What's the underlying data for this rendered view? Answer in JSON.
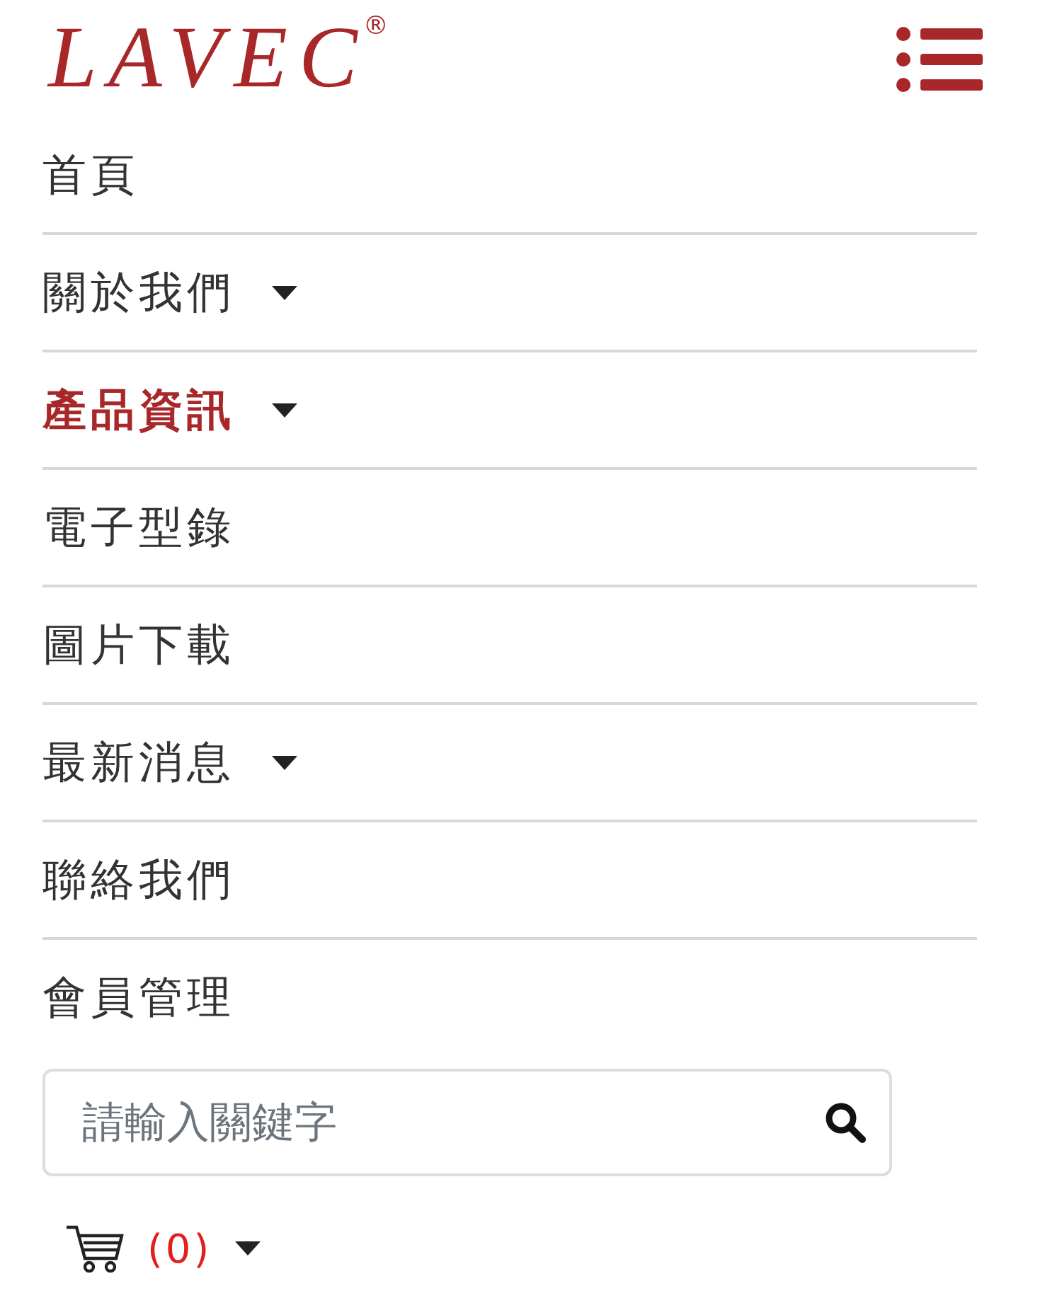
{
  "logo": {
    "text": "LAVEC",
    "mark": "®"
  },
  "menu": [
    {
      "label": "首頁",
      "selected": false,
      "dropdown": false
    },
    {
      "label": "關於我們",
      "selected": false,
      "dropdown": true
    },
    {
      "label": "產品資訊",
      "selected": true,
      "dropdown": true
    },
    {
      "label": "電子型錄",
      "selected": false,
      "dropdown": false
    },
    {
      "label": "圖片下載",
      "selected": false,
      "dropdown": false
    },
    {
      "label": "最新消息",
      "selected": false,
      "dropdown": true
    },
    {
      "label": "聯絡我們",
      "selected": false,
      "dropdown": false
    },
    {
      "label": "會員管理",
      "selected": false,
      "dropdown": false
    }
  ],
  "search": {
    "placeholder": "請輸入關鍵字"
  },
  "cart": {
    "count": "(0)"
  }
}
